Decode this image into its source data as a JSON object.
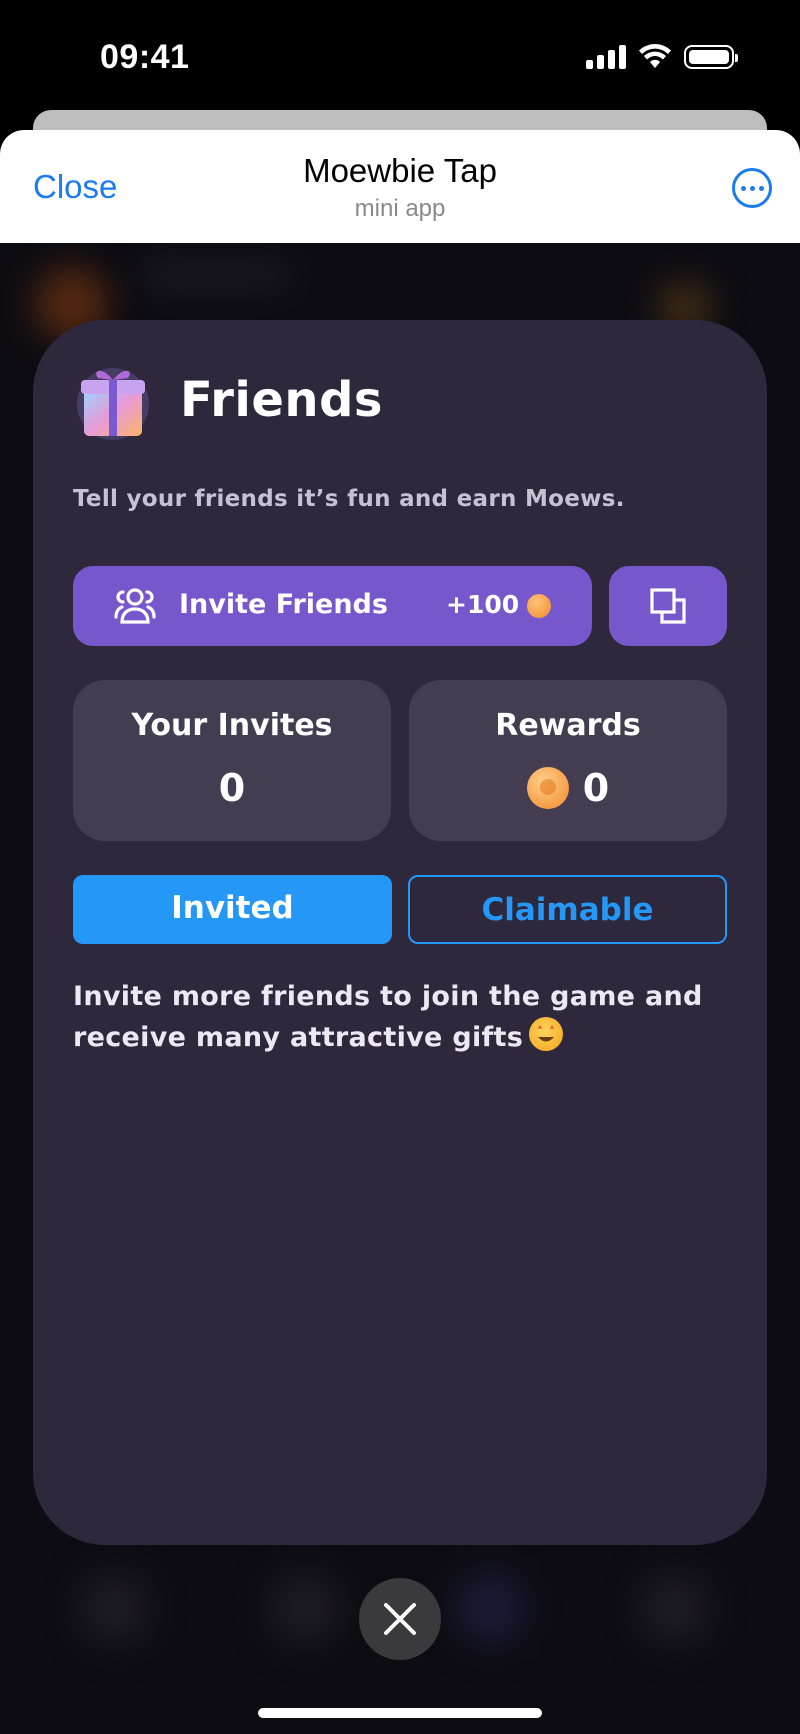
{
  "status_bar": {
    "time": "09:41"
  },
  "header": {
    "close_label": "Close",
    "title": "Moewbie Tap",
    "subtitle": "mini app"
  },
  "card": {
    "title": "Friends",
    "description": "Tell your friends it’s fun and earn Moews.",
    "invite_button": {
      "label": "Invite Friends",
      "reward": "+100"
    },
    "stats": {
      "invites_label": "Your Invites",
      "invites_value": "0",
      "rewards_label": "Rewards",
      "rewards_value": "0"
    },
    "tabs": {
      "invited": "Invited",
      "claimable": "Claimable",
      "active": "invited"
    },
    "info_text": "Invite more friends to join the game and receive many attractive gifts"
  },
  "colors": {
    "accent_purple": "#7658cc",
    "accent_blue": "#2497f7",
    "card_bg": "#2e283d",
    "stat_bg": "#443c51",
    "ios_link": "#1d7bf0"
  }
}
